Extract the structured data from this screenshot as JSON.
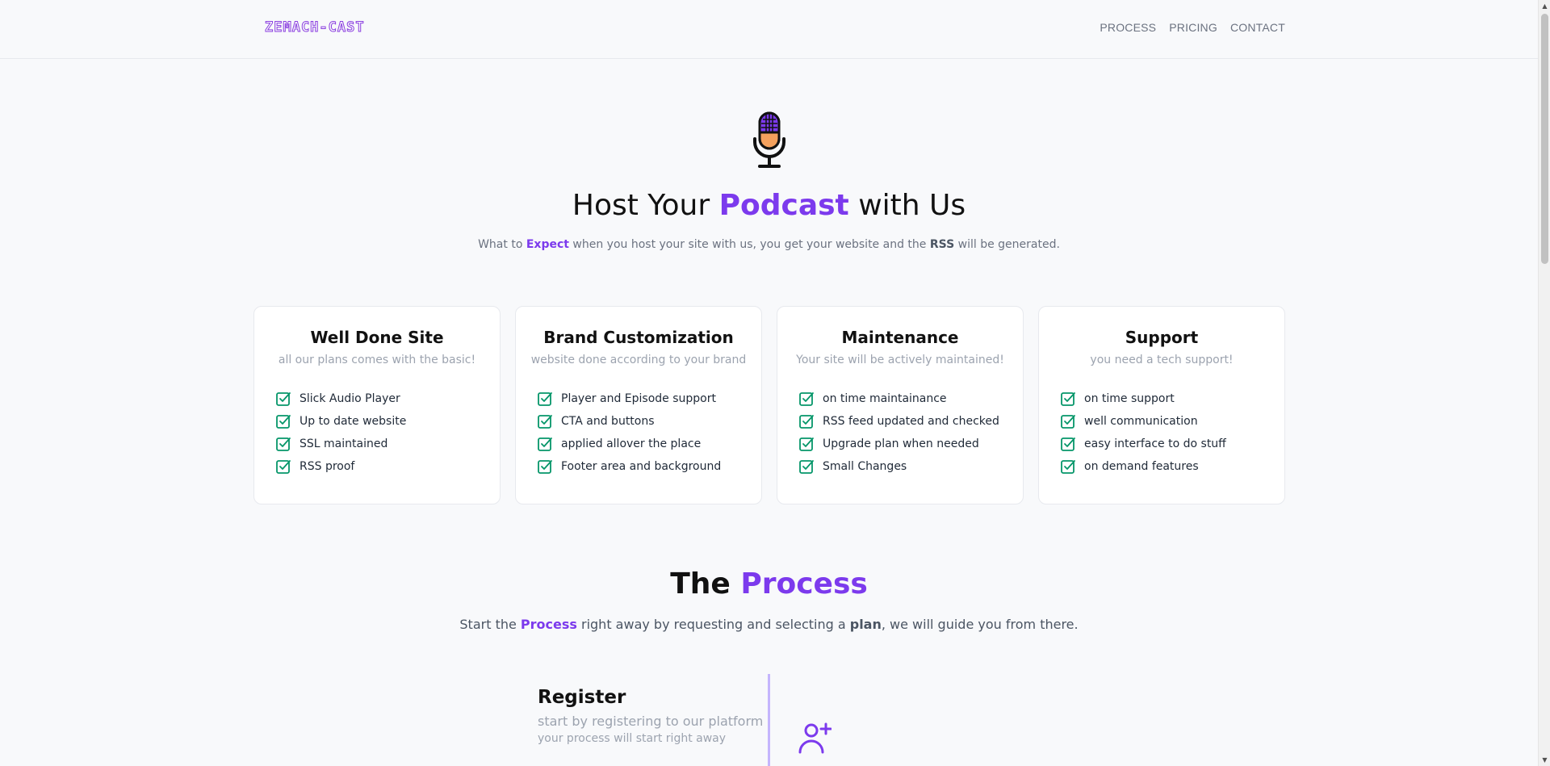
{
  "header": {
    "logo": "ZEMACH-CAST",
    "nav": [
      "PROCESS",
      "PRICING",
      "CONTACT"
    ]
  },
  "hero": {
    "title_before": "Host Your ",
    "title_highlight": "Podcast",
    "title_after": " with Us",
    "sub_1": "What to ",
    "sub_expect": "Expect",
    "sub_2": " when you host your site with us, you get your website and the ",
    "sub_rss": "RSS",
    "sub_3": " will be generated.",
    "icon": "microphone-icon"
  },
  "cards": [
    {
      "title": "Well Done Site",
      "subtitle": "all our plans comes with the basic!",
      "items": [
        "Slick Audio Player",
        "Up to date website",
        "SSL maintained",
        "RSS proof"
      ]
    },
    {
      "title": "Brand Customization",
      "subtitle": "website done according to your brand",
      "items": [
        "Player and Episode support",
        "CTA and buttons",
        "applied allover the place",
        "Footer area and background"
      ]
    },
    {
      "title": "Maintenance",
      "subtitle": "Your site will be actively maintained!",
      "items": [
        "on time maintainance",
        "RSS feed updated and checked",
        "Upgrade plan when needed",
        "Small Changes"
      ]
    },
    {
      "title": "Support",
      "subtitle": "you need a tech support!",
      "items": [
        "on time support",
        "well communication",
        "easy interface to do stuff",
        "on demand features"
      ]
    }
  ],
  "process": {
    "title_before": "The ",
    "title_highlight": "Process",
    "sub_1": "Start the ",
    "sub_process": "Process",
    "sub_2": " right away by requesting and selecting a ",
    "sub_plan": "plan",
    "sub_3": ", we will guide you from there.",
    "step": {
      "title": "Register",
      "line1": "start by registering to our platform",
      "line2": "your process will start right away",
      "icon": "user-plus-icon"
    }
  },
  "colors": {
    "accent": "#7c3aed",
    "check": "#059669",
    "mic_body": "#f4a15d",
    "mic_head": "#7c3aed"
  }
}
